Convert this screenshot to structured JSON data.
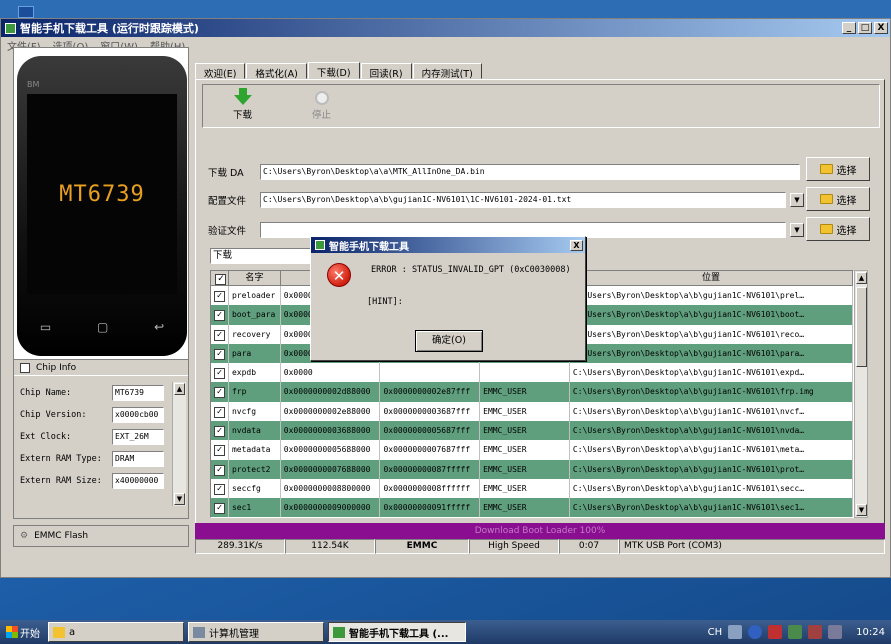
{
  "window": {
    "title": "智能手机下载工具 (运行时跟踪模式)",
    "controls": [
      "_",
      "□",
      "X"
    ]
  },
  "menu": [
    "文件(F)",
    "选项(O)",
    "窗口(W)",
    "帮助(H)"
  ],
  "phone": {
    "chip_label": "MT6739",
    "brand": "BM"
  },
  "chip_info": {
    "title": "Chip Info",
    "rows": [
      {
        "label": "Chip Name:",
        "value": "MT6739"
      },
      {
        "label": "Chip Version:",
        "value": "x0000cb00"
      },
      {
        "label": "Ext Clock:",
        "value": "EXT_26M"
      },
      {
        "label": "Extern RAM Type:",
        "value": "DRAM"
      },
      {
        "label": "Extern RAM Size:",
        "value": "x40000000"
      }
    ]
  },
  "emmc_flash": "EMMC Flash",
  "tabs": [
    "欢迎(E)",
    "格式化(A)",
    "下载(D)",
    "回读(R)",
    "内存测试(T)"
  ],
  "active_tab": 2,
  "toolbar": {
    "download": "下载",
    "stop": "停止"
  },
  "files": {
    "da_label": "下载 DA",
    "da_path": "C:\\Users\\Byron\\Desktop\\a\\a\\MTK_AllInOne_DA.bin",
    "config_label": "配置文件",
    "config_path": "C:\\Users\\Byron\\Desktop\\a\\b\\gujian1C-NV6101\\1C-NV6101-2024-01.txt",
    "verify_label": "验证文件",
    "verify_path": "",
    "select_label": "选择"
  },
  "mode_select": "下载",
  "table": {
    "headers": [
      "",
      "名字",
      "",
      "",
      "",
      "位置"
    ],
    "rows": [
      {
        "checked": true,
        "name": "preloader",
        "begin": "0x0000",
        "end": "",
        "region": "",
        "location": "C:\\Users\\Byron\\Desktop\\a\\b\\gujian1C-NV6101\\prel…",
        "green": false
      },
      {
        "checked": true,
        "name": "boot_para",
        "begin": "0x0000",
        "end": "",
        "region": "",
        "location": "C:\\Users\\Byron\\Desktop\\a\\b\\gujian1C-NV6101\\boot…",
        "green": true
      },
      {
        "checked": true,
        "name": "recovery",
        "begin": "0x0000",
        "end": "",
        "region": "",
        "location": "C:\\Users\\Byron\\Desktop\\a\\b\\gujian1C-NV6101\\reco…",
        "green": false
      },
      {
        "checked": true,
        "name": "para",
        "begin": "0x0000",
        "end": "",
        "region": "",
        "location": "C:\\Users\\Byron\\Desktop\\a\\b\\gujian1C-NV6101\\para…",
        "green": true
      },
      {
        "checked": true,
        "name": "expdb",
        "begin": "0x0000",
        "end": "",
        "region": "",
        "location": "C:\\Users\\Byron\\Desktop\\a\\b\\gujian1C-NV6101\\expd…",
        "green": false
      },
      {
        "checked": true,
        "name": "frp",
        "begin": "0x0000000002d88000",
        "end": "0x0000000002e87fff",
        "region": "EMMC_USER",
        "location": "C:\\Users\\Byron\\Desktop\\a\\b\\gujian1C-NV6101\\frp.img",
        "green": true
      },
      {
        "checked": true,
        "name": "nvcfg",
        "begin": "0x0000000002e88000",
        "end": "0x0000000003687fff",
        "region": "EMMC_USER",
        "location": "C:\\Users\\Byron\\Desktop\\a\\b\\gujian1C-NV6101\\nvcf…",
        "green": false
      },
      {
        "checked": true,
        "name": "nvdata",
        "begin": "0x0000000003688000",
        "end": "0x0000000005687fff",
        "region": "EMMC_USER",
        "location": "C:\\Users\\Byron\\Desktop\\a\\b\\gujian1C-NV6101\\nvda…",
        "green": true
      },
      {
        "checked": true,
        "name": "metadata",
        "begin": "0x0000000005688000",
        "end": "0x0000000007687fff",
        "region": "EMMC_USER",
        "location": "C:\\Users\\Byron\\Desktop\\a\\b\\gujian1C-NV6101\\meta…",
        "green": false
      },
      {
        "checked": true,
        "name": "protect2",
        "begin": "0x0000000007688000",
        "end": "0x00000000087fffff",
        "region": "EMMC_USER",
        "location": "C:\\Users\\Byron\\Desktop\\a\\b\\gujian1C-NV6101\\prot…",
        "green": true
      },
      {
        "checked": true,
        "name": "seccfg",
        "begin": "0x0000000008800000",
        "end": "0x0000000008ffffff",
        "region": "EMMC_USER",
        "location": "C:\\Users\\Byron\\Desktop\\a\\b\\gujian1C-NV6101\\secc…",
        "green": false
      },
      {
        "checked": true,
        "name": "sec1",
        "begin": "0x0000000009000000",
        "end": "0x00000000091fffff",
        "region": "EMMC_USER",
        "location": "C:\\Users\\Byron\\Desktop\\a\\b\\gujian1C-NV6101\\sec1…",
        "green": true
      }
    ]
  },
  "progress": {
    "text": "Download Boot Loader 100%",
    "percent": 100
  },
  "status": [
    "289.31K/s",
    "112.54K",
    "EMMC",
    "High Speed",
    "0:07",
    "MTK USB Port (COM3)"
  ],
  "dialog": {
    "title": "智能手机下载工具",
    "message": "ERROR : STATUS_INVALID_GPT (0xC0030008)",
    "hint": "[HINT]:",
    "ok_label": "确定(O)"
  },
  "taskbar": {
    "start_label": "开始",
    "items": [
      "a",
      "计算机管理",
      "智能手机下载工具 (..."
    ],
    "active_index": 2,
    "lang": "CH",
    "clock": "10:24"
  },
  "colors": {
    "title_bar": "#0a246a",
    "row_green": "#5f9f7e",
    "progress": "#8a0f90",
    "error_red": "#d02010"
  }
}
